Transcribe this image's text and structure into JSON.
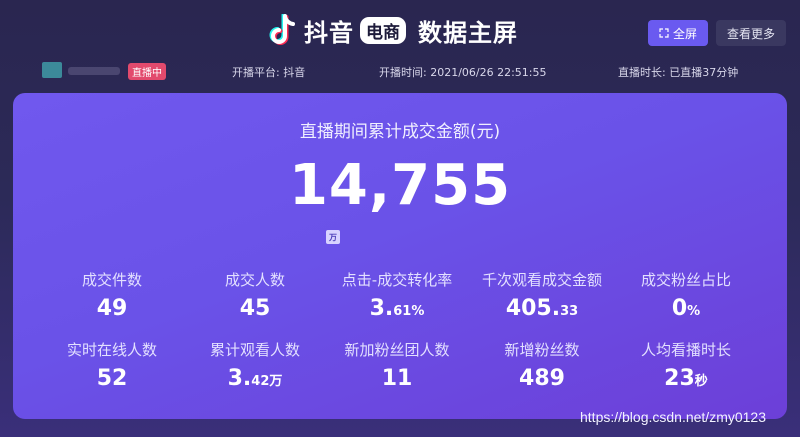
{
  "header": {
    "brand_name": "抖音",
    "brand_badge": "电商",
    "dashboard_title": "数据主屏",
    "fullscreen_label": "全屏",
    "more_label": "查看更多"
  },
  "info_bar": {
    "live_badge": "直播中",
    "platform": "开播平台: 抖音",
    "start_time": "开播时间: 2021/06/26 22:51:55",
    "duration": "直播时长: 已直播37分钟"
  },
  "summary": {
    "title": "直播期间累计成交金额(元)",
    "value": "14,755",
    "unit": "万"
  },
  "metrics_row1": [
    {
      "label": "成交件数",
      "value": "49",
      "suffix": ""
    },
    {
      "label": "成交人数",
      "value": "45",
      "suffix": ""
    },
    {
      "label": "点击-成交转化率",
      "value": "3.",
      "suffix": "61%"
    },
    {
      "label": "千次观看成交金额",
      "value": "405.",
      "suffix": "33"
    },
    {
      "label": "成交粉丝占比",
      "value": "0",
      "suffix": "%"
    }
  ],
  "metrics_row2": [
    {
      "label": "实时在线人数",
      "value": "52",
      "suffix": ""
    },
    {
      "label": "累计观看人数",
      "value": "3.",
      "suffix": "42万"
    },
    {
      "label": "新加粉丝团人数",
      "value": "11",
      "suffix": ""
    },
    {
      "label": "新增粉丝数",
      "value": "489",
      "suffix": ""
    },
    {
      "label": "人均看播时长",
      "value": "23",
      "suffix": "秒"
    }
  ],
  "watermark": "https://blog.csdn.net/zmy0123",
  "colors": {
    "background": "#2a2650",
    "card": "#7058ee",
    "accent_button": "#6a5af0",
    "live_badge": "#e24a6d"
  }
}
